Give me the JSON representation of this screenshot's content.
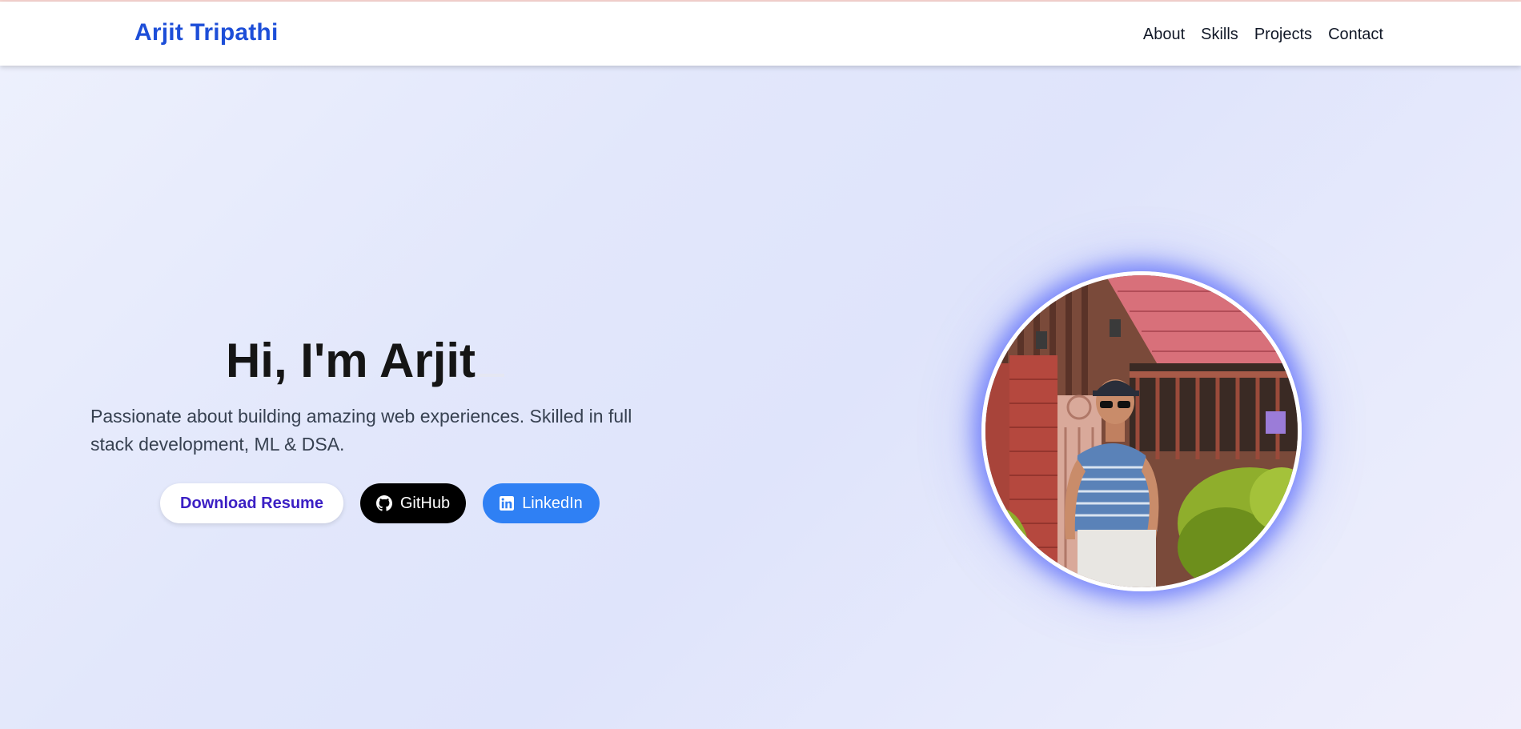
{
  "header": {
    "brand": "Arjit Tripathi",
    "nav": [
      "About",
      "Skills",
      "Projects",
      "Contact"
    ]
  },
  "hero": {
    "title": "Hi, I'm Arjit",
    "tagline": "Passionate about building amazing web experiences. Skilled in full stack development, ML & DSA.",
    "buttons": {
      "resume": "Download Resume",
      "github": "GitHub",
      "linkedin": "LinkedIn"
    }
  },
  "icons": {
    "github": "github-icon",
    "linkedin": "linkedin-icon"
  },
  "colors": {
    "brand": "#1d4ed8",
    "resume_text": "#3b1fc4",
    "github_bg": "#000000",
    "linkedin_bg": "#2f80f4",
    "photo_glow": "#4a5cfa"
  }
}
